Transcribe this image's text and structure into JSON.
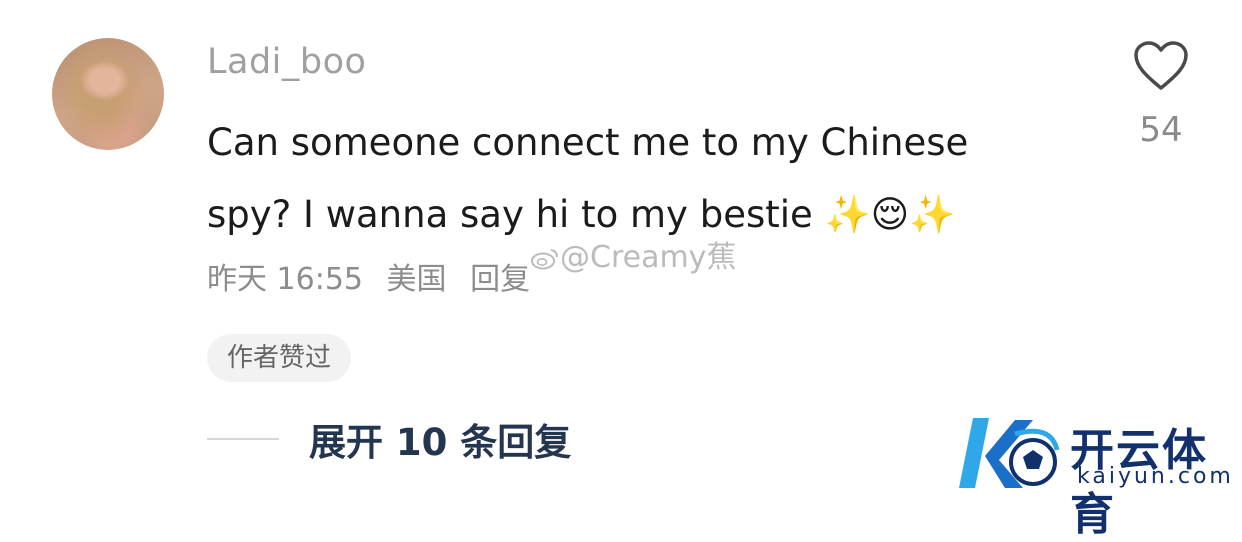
{
  "comment": {
    "username": "Ladi_boo",
    "text_line1": "Can someone connect me to my Chinese",
    "text_line2": "spy? I wanna say hi to my bestie ✨😌✨",
    "time": "昨天 16:55",
    "location": "美国",
    "reply_label": "回复",
    "author_badge": "作者赞过",
    "expand_label": "展开 10 条回复"
  },
  "like": {
    "count": "54",
    "icon": "heart-outline-icon"
  },
  "watermark": {
    "text": "@Creamy蕉"
  },
  "brand": {
    "name_cn": "开云体育",
    "name_en": "kaiyun.com",
    "colors": {
      "primary": "#12306b",
      "accent": "#2ea8e8"
    }
  }
}
